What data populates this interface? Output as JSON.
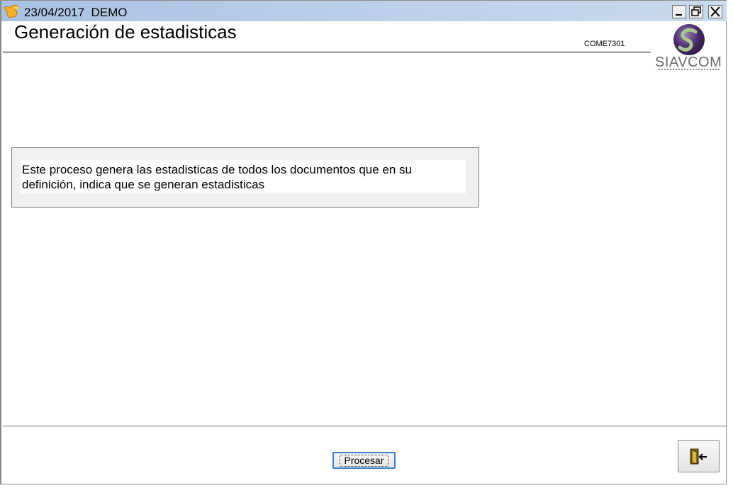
{
  "titlebar": {
    "title": "23/04/2017  DEMO",
    "minimize_icon": "minimize-icon",
    "restore_icon": "restore-icon",
    "close_icon": "close-icon"
  },
  "header": {
    "title": "Generación de estadisticas",
    "form_code": "COME7301"
  },
  "logo": {
    "text": "SIAVCOM"
  },
  "info": {
    "message": "Este proceso genera las estadisticas  de todos los documentos que en su definición, indica que se generan estadisticas"
  },
  "footer": {
    "process_label": "Procesar",
    "exit_icon": "exit-door-icon"
  },
  "colors": {
    "titlebar": "#bcd0ea",
    "focus_border": "#3b7fd6",
    "logo_purple": "#4a2c6e",
    "logo_green": "#8fb27a"
  }
}
